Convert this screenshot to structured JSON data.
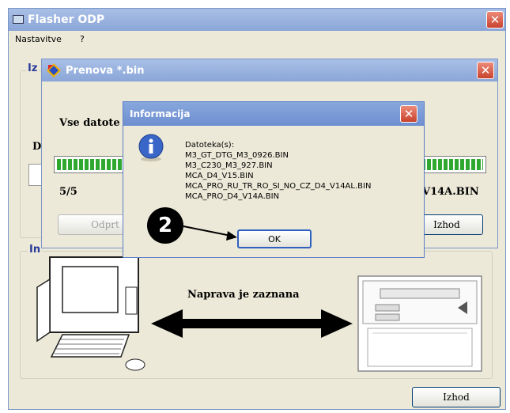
{
  "main_window": {
    "title": "Flasher ODP",
    "menu": [
      "Nastavitve",
      "?"
    ],
    "partial_labels": {
      "group1": "Iz",
      "group2": "In",
      "left_d": "D"
    },
    "status_text": "Naprava je zaznana",
    "exit_button": "Izhod"
  },
  "renova_window": {
    "title": "Prenova *.bin",
    "all_files_label": "Vse datote",
    "progress_count": "5/5",
    "current_file_tail": "V14A.BIN",
    "open_button": "Odprt",
    "exit_button": "Izhod",
    "progress_left_fraction": 1.0,
    "progress_right_fraction": 1.0
  },
  "info_dialog": {
    "title": "Informacija",
    "lines": [
      "Datoteka(s):",
      "M3_GT_DTG_M3_0926.BIN",
      "M3_C230_M3_927.BIN",
      "MCA_D4_V15.BIN",
      "MCA_PRO_RU_TR_RO_SI_NO_CZ_D4_V14AL.BIN",
      "MCA_PRO_D4_V14A.BIN"
    ],
    "ok_button": "OK",
    "icon": "info-icon"
  },
  "callout": {
    "number": "2"
  },
  "colors": {
    "titlebar": "#8aa6d8",
    "window_bg": "#ece9d8",
    "progress_green": "#2fa82f",
    "close_red": "#c9432e"
  }
}
